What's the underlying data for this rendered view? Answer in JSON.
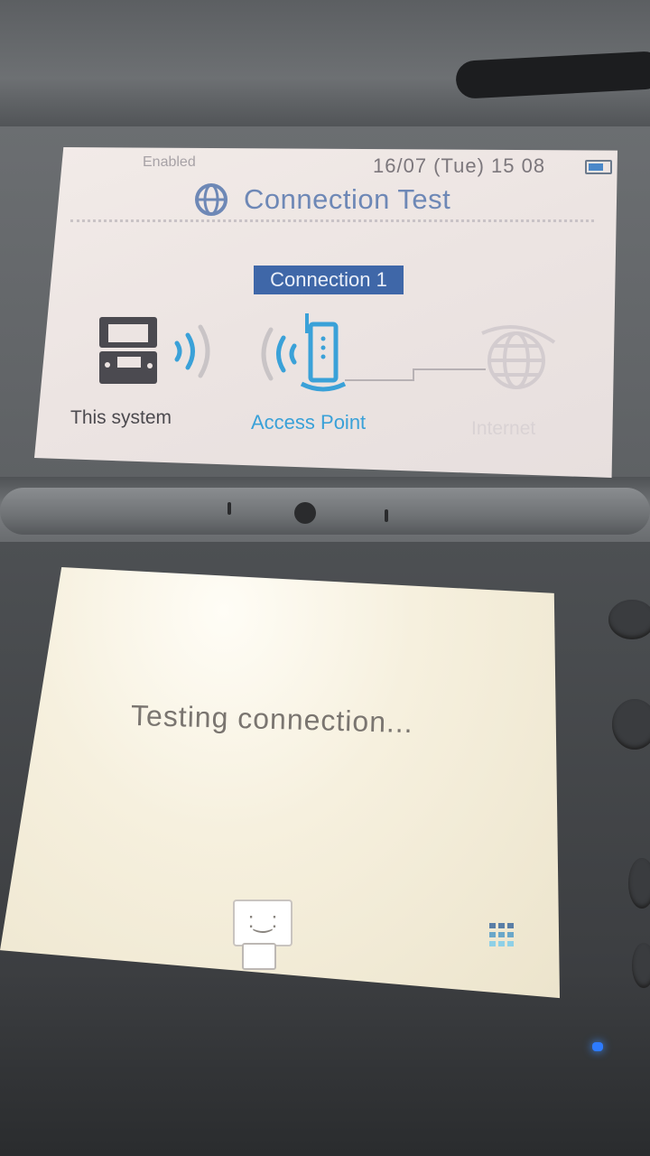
{
  "top_screen": {
    "status": {
      "left": "Enabled",
      "datetime": "16/07 (Tue)  15 08"
    },
    "title": "Connection Test",
    "connection_label": "Connection 1",
    "nodes": {
      "system": "This system",
      "access_point": "Access Point",
      "internet": "Internet"
    },
    "icons": {
      "title": "connection-globe-icon",
      "system": "console-icon",
      "access_point": "router-icon",
      "internet": "globe-icon",
      "battery": "battery-icon"
    }
  },
  "bottom_screen": {
    "message": "Testing connection...",
    "icons": {
      "mascot": "mascot-icon",
      "menu": "grid-menu-icon"
    }
  },
  "colors": {
    "accent_blue": "#3aa1d8",
    "badge_blue": "#3f67a8",
    "title_blue": "#6e88b6",
    "led": "#2d7bff"
  }
}
